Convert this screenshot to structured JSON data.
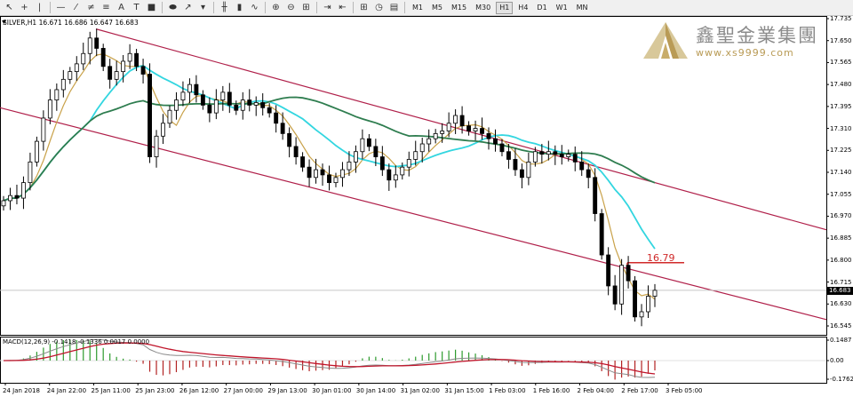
{
  "toolbar": {
    "tools": [
      {
        "name": "cursor-icon",
        "glyph": "↖"
      },
      {
        "name": "crosshair-icon",
        "glyph": "+"
      },
      {
        "name": "vertical-line-icon",
        "glyph": "|"
      },
      {
        "name": "horizontal-line-icon",
        "glyph": "—"
      },
      {
        "name": "trendline-icon",
        "glyph": "⁄"
      },
      {
        "name": "channel-icon",
        "glyph": "≠"
      },
      {
        "name": "fibonacci-icon",
        "glyph": "≡"
      },
      {
        "name": "text-icon",
        "glyph": "A"
      },
      {
        "name": "label-icon",
        "glyph": "T"
      },
      {
        "name": "rectangle-icon",
        "glyph": "■"
      },
      {
        "name": "ellipse-icon",
        "glyph": "⬬"
      },
      {
        "name": "arrow-icon",
        "glyph": "↗"
      },
      {
        "name": "tools-dropdown-icon",
        "glyph": "▾"
      }
    ],
    "chart_tools": [
      {
        "name": "bar-chart-icon",
        "glyph": "╫"
      },
      {
        "name": "candlestick-icon",
        "glyph": "▮"
      },
      {
        "name": "line-chart-icon",
        "glyph": "∿"
      },
      {
        "name": "zoom-in-icon",
        "glyph": "⊕"
      },
      {
        "name": "zoom-out-icon",
        "glyph": "⊖"
      },
      {
        "name": "tile-windows-icon",
        "glyph": "⊞"
      },
      {
        "name": "auto-scroll-icon",
        "glyph": "⇥"
      },
      {
        "name": "chart-shift-icon",
        "glyph": "⇤"
      },
      {
        "name": "indicators-icon",
        "glyph": "⊞"
      },
      {
        "name": "periods-icon",
        "glyph": "◷"
      },
      {
        "name": "templates-icon",
        "glyph": "▤"
      }
    ],
    "timeframes": [
      "M1",
      "M5",
      "M15",
      "M30",
      "H1",
      "H4",
      "D1",
      "W1",
      "MN"
    ],
    "active_timeframe": "H1"
  },
  "chart": {
    "title": "SILVER,H1  16.671 16.686 16.647 16.683",
    "current_price": "16.683",
    "level_label": "16.79",
    "macd_title": "MACD(12,26,9) -0.1418 -0.1336 0.0017 0.0000"
  },
  "logo": {
    "name_cn": "鑫聖金業集團",
    "url": "www.xs9999.com"
  },
  "colors": {
    "channel": "#b0204a",
    "ma_fast": "#c9a24a",
    "ma_cyan": "#33d6e0",
    "ma_green": "#2e7d4f",
    "level": "#d02a2a",
    "macd_signal": "#c0152b",
    "macd_hist_pos": "#2e9b2e",
    "macd_hist_neg": "#b22222"
  },
  "chart_data": {
    "type": "candlestick",
    "symbol": "SILVER",
    "timeframe": "H1",
    "price_ticks": [
      "17.735",
      "17.650",
      "17.565",
      "17.480",
      "17.395",
      "17.310",
      "17.225",
      "17.140",
      "17.055",
      "16.970",
      "16.885",
      "16.800",
      "16.715",
      "16.630",
      "16.545"
    ],
    "time_ticks": [
      "24 Jan 2018",
      "24 Jan 22:00",
      "25 Jan 11:00",
      "25 Jan 23:00",
      "26 Jan 12:00",
      "27 Jan 00:00",
      "29 Jan 13:00",
      "30 Jan 01:00",
      "30 Jan 14:00",
      "31 Jan 02:00",
      "31 Jan 15:00",
      "1 Feb 03:00",
      "1 Feb 16:00",
      "2 Feb 04:00",
      "2 Feb 17:00",
      "3 Feb 05:00"
    ],
    "macd_ticks": [
      "0.1487",
      "0.00",
      "-0.1762"
    ],
    "ohlc_last": {
      "open": 16.671,
      "high": 16.686,
      "low": 16.647,
      "close": 16.683
    },
    "closes": [
      17.03,
      17.05,
      17.04,
      17.1,
      17.18,
      17.26,
      17.35,
      17.42,
      17.46,
      17.5,
      17.53,
      17.56,
      17.6,
      17.66,
      17.62,
      17.55,
      17.5,
      17.53,
      17.57,
      17.6,
      17.55,
      17.52,
      17.2,
      17.28,
      17.33,
      17.38,
      17.42,
      17.45,
      17.48,
      17.44,
      17.4,
      17.37,
      17.42,
      17.45,
      17.4,
      17.38,
      17.42,
      17.4,
      17.41,
      17.39,
      17.37,
      17.33,
      17.29,
      17.24,
      17.2,
      17.16,
      17.12,
      17.15,
      17.13,
      17.1,
      17.12,
      17.15,
      17.18,
      17.22,
      17.27,
      17.24,
      17.2,
      17.15,
      17.11,
      17.13,
      17.16,
      17.19,
      17.22,
      17.25,
      17.27,
      17.29,
      17.3,
      17.33,
      17.36,
      17.32,
      17.3,
      17.31,
      17.29,
      17.27,
      17.25,
      17.22,
      17.19,
      17.15,
      17.12,
      17.18,
      17.22,
      17.21,
      17.22,
      17.21,
      17.2,
      17.21,
      17.18,
      17.15,
      17.12,
      16.98,
      16.82,
      16.7,
      16.63,
      16.78,
      16.72,
      16.58,
      16.6,
      16.66,
      16.683
    ],
    "level": 16.79,
    "channel": {
      "upper": [
        {
          "x": "25 Jan 11:00",
          "y": 17.695
        },
        {
          "x": "3 Feb 05:00",
          "y": 17.1
        }
      ],
      "lower": [
        {
          "x": "24 Jan 2018",
          "y": 17.39
        },
        {
          "x": "3 Feb 05:00",
          "y": 16.74
        }
      ]
    },
    "series": [
      {
        "name": "MA fast",
        "color": "#c9a24a"
      },
      {
        "name": "MA medium",
        "color": "#33d6e0"
      },
      {
        "name": "MA slow",
        "color": "#2e7d4f"
      }
    ],
    "ylim": [
      16.5,
      17.76
    ]
  }
}
